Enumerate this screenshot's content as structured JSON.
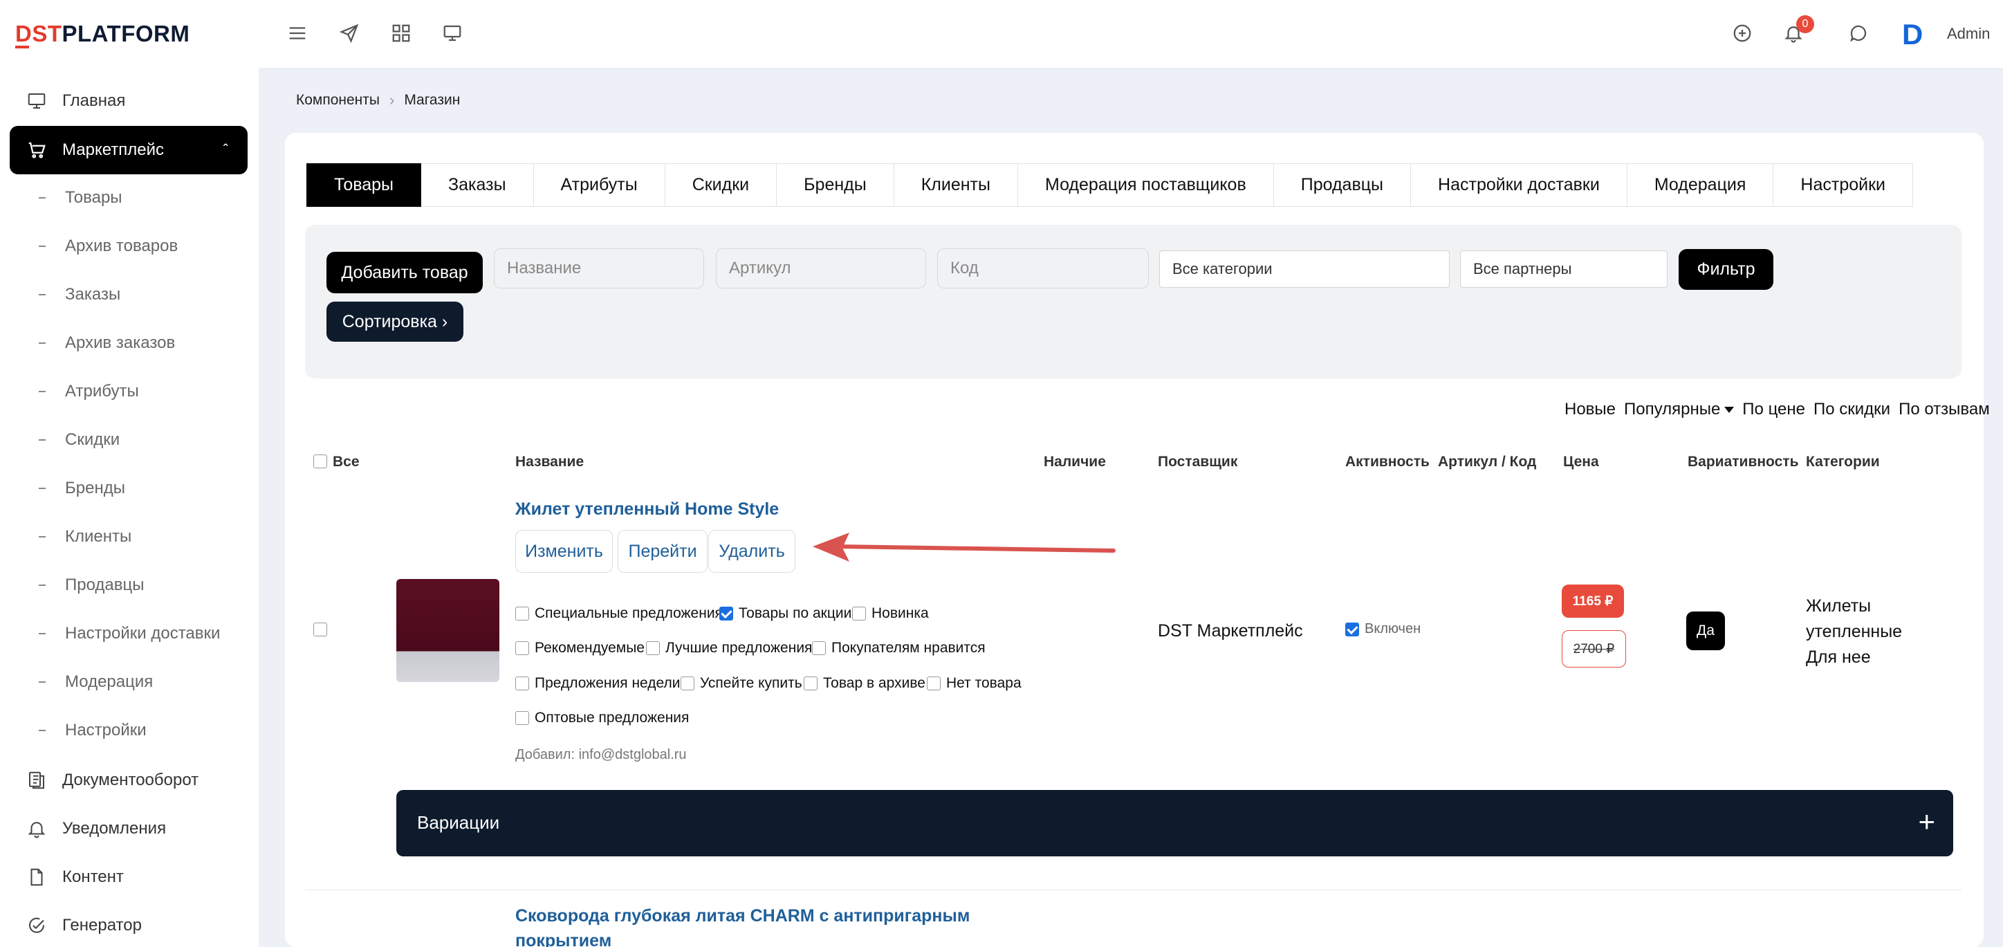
{
  "header": {
    "logo_accent": "DST",
    "logo_rest": "PLATFORM",
    "notification_count": "0",
    "user_initial": "D",
    "user_name": "Admin"
  },
  "sidebar": {
    "items": [
      {
        "label": "Главная",
        "icon": "monitor-icon"
      },
      {
        "label": "Маркетплейс",
        "icon": "cart-icon",
        "active": true
      }
    ],
    "subitems": [
      "Товары",
      "Архив товаров",
      "Заказы",
      "Архив заказов",
      "Атрибуты",
      "Скидки",
      "Бренды",
      "Клиенты",
      "Продавцы",
      "Настройки доставки",
      "Модерация",
      "Настройки"
    ],
    "bottom_items": [
      {
        "label": "Документооборот",
        "icon": "documents-icon"
      },
      {
        "label": "Уведомления",
        "icon": "bell-icon"
      },
      {
        "label": "Контент",
        "icon": "file-icon"
      },
      {
        "label": "Генератор",
        "icon": "check-circle-icon"
      }
    ]
  },
  "breadcrumb": {
    "items": [
      "Компоненты",
      "Магазин"
    ]
  },
  "tabs": [
    "Товары",
    "Заказы",
    "Атрибуты",
    "Скидки",
    "Бренды",
    "Клиенты",
    "Модерация поставщиков",
    "Продавцы",
    "Настройки доставки",
    "Модерация",
    "Настройки"
  ],
  "filters": {
    "add_button": "Добавить товар",
    "name_placeholder": "Название",
    "sku_placeholder": "Артикул",
    "code_placeholder": "Код",
    "category_select": "Все категории",
    "partner_select": "Все партнеры",
    "filter_button": "Фильтр",
    "sort_button": "Сортировка ›"
  },
  "sort_options": [
    "Новые",
    "Популярные",
    "По цене",
    "По скидки",
    "По отзывам"
  ],
  "table": {
    "headers": {
      "all": "Все",
      "name": "Название",
      "availability": "Наличие",
      "supplier": "Поставщик",
      "activity": "Активность",
      "sku_code": "Артикул / Код",
      "price": "Цена",
      "variativity": "Вариативность",
      "categories": "Категории"
    }
  },
  "product": {
    "title": "Жилет утепленный Home Style",
    "actions": [
      "Изменить",
      "Перейти",
      "Удалить"
    ],
    "flags": [
      {
        "label": "Специальные предложения",
        "checked": false
      },
      {
        "label": "Товары по акции",
        "checked": true
      },
      {
        "label": "Новинка",
        "checked": false
      },
      {
        "label": "Рекомендуемые",
        "checked": false
      },
      {
        "label": "Лучшие предложения",
        "checked": false
      },
      {
        "label": "Покупателям нравится",
        "checked": false
      },
      {
        "label": "Предложения недели",
        "checked": false
      },
      {
        "label": "Успейте купить",
        "checked": false
      },
      {
        "label": "Товар в архиве",
        "checked": false
      },
      {
        "label": "Нет товара",
        "checked": false
      },
      {
        "label": "Оптовые предложения",
        "checked": false
      }
    ],
    "added_by": "Добавил: info@dstglobal.ru",
    "supplier": "DST Маркетплейс",
    "active_label": "Включен",
    "price_new": "1165 ₽",
    "price_old": "2700 ₽",
    "variativity": "Да",
    "categories": [
      "Жилеты",
      "утепленные",
      "Для нее"
    ],
    "variations_label": "Вариации"
  },
  "product2": {
    "title": "Сковорода глубокая литая CHARM с антипригарным покрытием"
  },
  "colors": {
    "accent": "#e43b2c",
    "link": "#1f5f99",
    "navy": "#0e1b2c",
    "price": "#e84b3c",
    "annotation_arrow": "#d9534f"
  }
}
